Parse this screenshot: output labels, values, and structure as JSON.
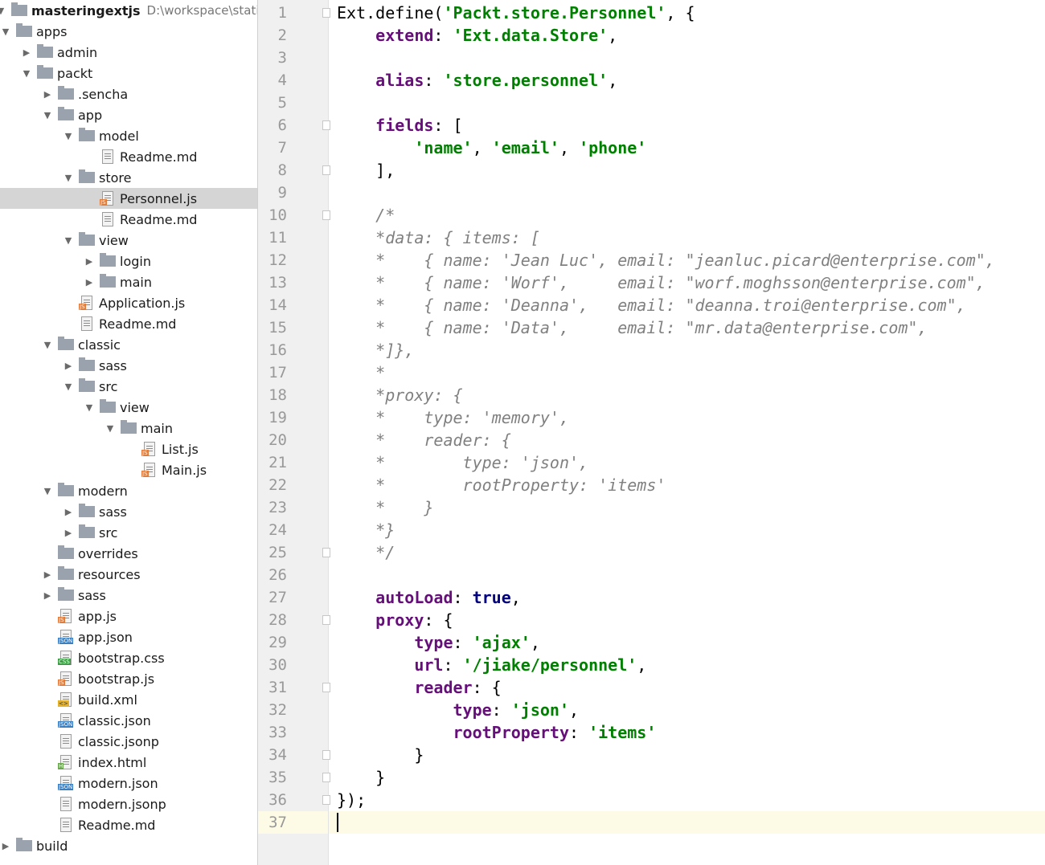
{
  "tree": {
    "root": {
      "label": "masteringextjs",
      "path": "D:\\workspace\\static\\ma"
    },
    "items": [
      {
        "label": "apps",
        "depth": 0,
        "kind": "folder",
        "open": true
      },
      {
        "label": "admin",
        "depth": 1,
        "kind": "folder",
        "open": false
      },
      {
        "label": "packt",
        "depth": 1,
        "kind": "folder",
        "open": true
      },
      {
        "label": ".sencha",
        "depth": 2,
        "kind": "folder",
        "open": false
      },
      {
        "label": "app",
        "depth": 2,
        "kind": "folder",
        "open": true
      },
      {
        "label": "model",
        "depth": 3,
        "kind": "folder",
        "open": true
      },
      {
        "label": "Readme.md",
        "depth": 4,
        "kind": "md"
      },
      {
        "label": "store",
        "depth": 3,
        "kind": "folder",
        "open": true
      },
      {
        "label": "Personnel.js",
        "depth": 4,
        "kind": "js",
        "selected": true
      },
      {
        "label": "Readme.md",
        "depth": 4,
        "kind": "md"
      },
      {
        "label": "view",
        "depth": 3,
        "kind": "folder",
        "open": true
      },
      {
        "label": "login",
        "depth": 4,
        "kind": "folder",
        "open": false
      },
      {
        "label": "main",
        "depth": 4,
        "kind": "folder",
        "open": false
      },
      {
        "label": "Application.js",
        "depth": 3,
        "kind": "js"
      },
      {
        "label": "Readme.md",
        "depth": 3,
        "kind": "md"
      },
      {
        "label": "classic",
        "depth": 2,
        "kind": "folder",
        "open": true
      },
      {
        "label": "sass",
        "depth": 3,
        "kind": "folder",
        "open": false
      },
      {
        "label": "src",
        "depth": 3,
        "kind": "folder",
        "open": true
      },
      {
        "label": "view",
        "depth": 4,
        "kind": "folder",
        "open": true
      },
      {
        "label": "main",
        "depth": 5,
        "kind": "folder",
        "open": true
      },
      {
        "label": "List.js",
        "depth": 6,
        "kind": "js"
      },
      {
        "label": "Main.js",
        "depth": 6,
        "kind": "js"
      },
      {
        "label": "modern",
        "depth": 2,
        "kind": "folder",
        "open": true
      },
      {
        "label": "sass",
        "depth": 3,
        "kind": "folder",
        "open": false
      },
      {
        "label": "src",
        "depth": 3,
        "kind": "folder",
        "open": false
      },
      {
        "label": "overrides",
        "depth": 2,
        "kind": "folder"
      },
      {
        "label": "resources",
        "depth": 2,
        "kind": "folder",
        "open": false
      },
      {
        "label": "sass",
        "depth": 2,
        "kind": "folder",
        "open": false
      },
      {
        "label": "app.js",
        "depth": 2,
        "kind": "js"
      },
      {
        "label": "app.json",
        "depth": 2,
        "kind": "json"
      },
      {
        "label": "bootstrap.css",
        "depth": 2,
        "kind": "css"
      },
      {
        "label": "bootstrap.js",
        "depth": 2,
        "kind": "js"
      },
      {
        "label": "build.xml",
        "depth": 2,
        "kind": "xml"
      },
      {
        "label": "classic.json",
        "depth": 2,
        "kind": "json"
      },
      {
        "label": "classic.jsonp",
        "depth": 2,
        "kind": "md"
      },
      {
        "label": "index.html",
        "depth": 2,
        "kind": "html"
      },
      {
        "label": "modern.json",
        "depth": 2,
        "kind": "json"
      },
      {
        "label": "modern.jsonp",
        "depth": 2,
        "kind": "md"
      },
      {
        "label": "Readme.md",
        "depth": 2,
        "kind": "md"
      },
      {
        "label": "build",
        "depth": 0,
        "kind": "folder",
        "open": false
      }
    ]
  },
  "editor": {
    "current_line": 37,
    "lines": [
      [
        [
          "plain",
          "Ext.define("
        ],
        [
          "str",
          "'Packt.store.Personnel'"
        ],
        [
          "plain",
          ", {"
        ]
      ],
      [
        [
          "plain",
          "    "
        ],
        [
          "prop",
          "extend"
        ],
        [
          "plain",
          ": "
        ],
        [
          "str",
          "'Ext.data.Store'"
        ],
        [
          "plain",
          ","
        ]
      ],
      [],
      [
        [
          "plain",
          "    "
        ],
        [
          "prop",
          "alias"
        ],
        [
          "plain",
          ": "
        ],
        [
          "str",
          "'store.personnel'"
        ],
        [
          "plain",
          ","
        ]
      ],
      [],
      [
        [
          "plain",
          "    "
        ],
        [
          "prop",
          "fields"
        ],
        [
          "plain",
          ": ["
        ]
      ],
      [
        [
          "plain",
          "        "
        ],
        [
          "str",
          "'name'"
        ],
        [
          "plain",
          ", "
        ],
        [
          "str",
          "'email'"
        ],
        [
          "plain",
          ", "
        ],
        [
          "str",
          "'phone'"
        ]
      ],
      [
        [
          "plain",
          "    ],"
        ]
      ],
      [],
      [
        [
          "cmt",
          "    /*"
        ]
      ],
      [
        [
          "cmt",
          "    *data: { items: ["
        ]
      ],
      [
        [
          "cmt",
          "    *    { name: 'Jean Luc', email: \"jeanluc.picard@enterprise.com\","
        ]
      ],
      [
        [
          "cmt",
          "    *    { name: 'Worf',     email: \"worf.moghsson@enterprise.com\","
        ]
      ],
      [
        [
          "cmt",
          "    *    { name: 'Deanna',   email: \"deanna.troi@enterprise.com\","
        ]
      ],
      [
        [
          "cmt",
          "    *    { name: 'Data',     email: \"mr.data@enterprise.com\","
        ]
      ],
      [
        [
          "cmt",
          "    *]},"
        ]
      ],
      [
        [
          "cmt",
          "    *"
        ]
      ],
      [
        [
          "cmt",
          "    *proxy: {"
        ]
      ],
      [
        [
          "cmt",
          "    *    type: 'memory',"
        ]
      ],
      [
        [
          "cmt",
          "    *    reader: {"
        ]
      ],
      [
        [
          "cmt",
          "    *        type: 'json',"
        ]
      ],
      [
        [
          "cmt",
          "    *        rootProperty: 'items'"
        ]
      ],
      [
        [
          "cmt",
          "    *    }"
        ]
      ],
      [
        [
          "cmt",
          "    *}"
        ]
      ],
      [
        [
          "cmt",
          "    */"
        ]
      ],
      [],
      [
        [
          "plain",
          "    "
        ],
        [
          "prop",
          "autoLoad"
        ],
        [
          "plain",
          ": "
        ],
        [
          "kw",
          "true"
        ],
        [
          "plain",
          ","
        ]
      ],
      [
        [
          "plain",
          "    "
        ],
        [
          "prop",
          "proxy"
        ],
        [
          "plain",
          ": {"
        ]
      ],
      [
        [
          "plain",
          "        "
        ],
        [
          "prop",
          "type"
        ],
        [
          "plain",
          ": "
        ],
        [
          "str",
          "'ajax'"
        ],
        [
          "plain",
          ","
        ]
      ],
      [
        [
          "plain",
          "        "
        ],
        [
          "prop",
          "url"
        ],
        [
          "plain",
          ": "
        ],
        [
          "str",
          "'/jiake/personnel'"
        ],
        [
          "plain",
          ","
        ]
      ],
      [
        [
          "plain",
          "        "
        ],
        [
          "prop",
          "reader"
        ],
        [
          "plain",
          ": {"
        ]
      ],
      [
        [
          "plain",
          "            "
        ],
        [
          "prop",
          "type"
        ],
        [
          "plain",
          ": "
        ],
        [
          "str",
          "'json'"
        ],
        [
          "plain",
          ","
        ]
      ],
      [
        [
          "plain",
          "            "
        ],
        [
          "prop",
          "rootProperty"
        ],
        [
          "plain",
          ": "
        ],
        [
          "str",
          "'items'"
        ]
      ],
      [
        [
          "plain",
          "        }"
        ]
      ],
      [
        [
          "plain",
          "    }"
        ]
      ],
      [
        [
          "plain",
          "});"
        ]
      ],
      []
    ]
  }
}
